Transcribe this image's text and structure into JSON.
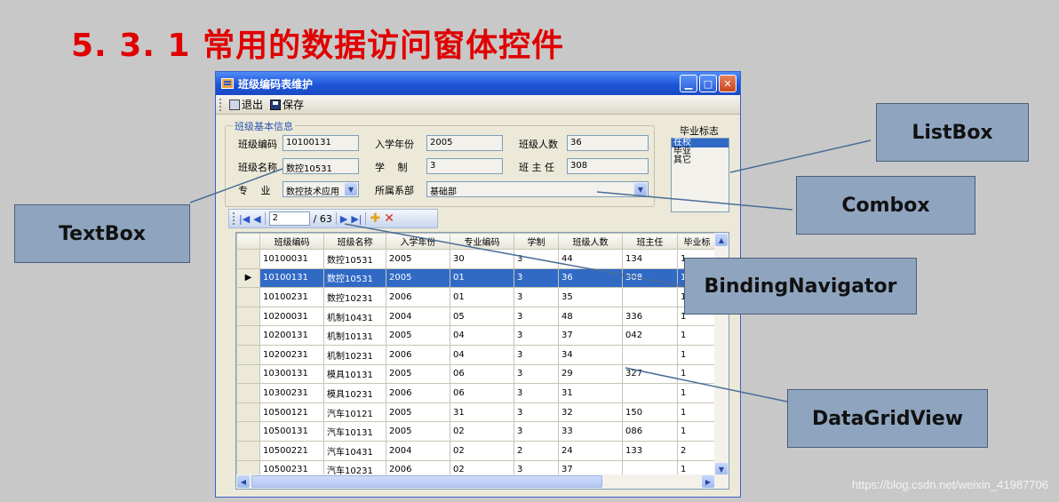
{
  "slide": {
    "title": "5. 3. 1  常用的数据访问窗体控件"
  },
  "window": {
    "title": "班级编码表维护",
    "toolbar": {
      "exit_label": "退出",
      "save_label": "保存"
    }
  },
  "group": {
    "title": "班级基本信息",
    "fields": {
      "class_code_label": "班级编码",
      "class_code_value": "10100131",
      "year_label": "入学年份",
      "year_value": "2005",
      "count_label": "班级人数",
      "count_value": "36",
      "class_name_label": "班级名称",
      "class_name_value": "数控10531",
      "duration_label": "学　 制",
      "duration_value": "3",
      "teacher_label": "班 主 任",
      "teacher_value": "308",
      "major_label": "专　 业",
      "major_value": "数控技术应用",
      "dept_label": "所属系部",
      "dept_value": "基础部"
    }
  },
  "listbox": {
    "label": "毕业标志",
    "items": [
      "在校",
      "毕业",
      "其它"
    ],
    "selected": "在校"
  },
  "navigator": {
    "position": "2",
    "total": "/ 63"
  },
  "grid": {
    "columns": [
      "班级编码",
      "班级名称",
      "入学年份",
      "专业编码",
      "学制",
      "班级人数",
      "班主任",
      "毕业标"
    ],
    "rows": [
      [
        "10100031",
        "数控10531",
        "2005",
        "30",
        "3",
        "44",
        "134",
        "1"
      ],
      [
        "10100131",
        "数控10531",
        "2005",
        "01",
        "3",
        "36",
        "308",
        "1"
      ],
      [
        "10100231",
        "数控10231",
        "2006",
        "01",
        "3",
        "35",
        "",
        "1"
      ],
      [
        "10200031",
        "机制10431",
        "2004",
        "05",
        "3",
        "48",
        "336",
        "1"
      ],
      [
        "10200131",
        "机制10131",
        "2005",
        "04",
        "3",
        "37",
        "042",
        "1"
      ],
      [
        "10200231",
        "机制10231",
        "2006",
        "04",
        "3",
        "34",
        "",
        "1"
      ],
      [
        "10300131",
        "模具10131",
        "2005",
        "06",
        "3",
        "29",
        "327",
        "1"
      ],
      [
        "10300231",
        "模具10231",
        "2006",
        "06",
        "3",
        "31",
        "",
        "1"
      ],
      [
        "10500121",
        "汽车10121",
        "2005",
        "31",
        "3",
        "32",
        "150",
        "1"
      ],
      [
        "10500131",
        "汽车10131",
        "2005",
        "02",
        "3",
        "33",
        "086",
        "1"
      ],
      [
        "10500221",
        "汽车10431",
        "2004",
        "02",
        "2",
        "24",
        "133",
        "2"
      ],
      [
        "10500231",
        "汽车10231",
        "2006",
        "02",
        "3",
        "37",
        "",
        "1"
      ]
    ],
    "selected_row": 1
  },
  "callouts": {
    "listbox": "ListBox",
    "combox": "Combox",
    "textbox": "TextBox",
    "bindingnavigator": "BindingNavigator",
    "datagridview": "DataGridView"
  },
  "watermark": "https://blog.csdn.net/weixin_41987706"
}
